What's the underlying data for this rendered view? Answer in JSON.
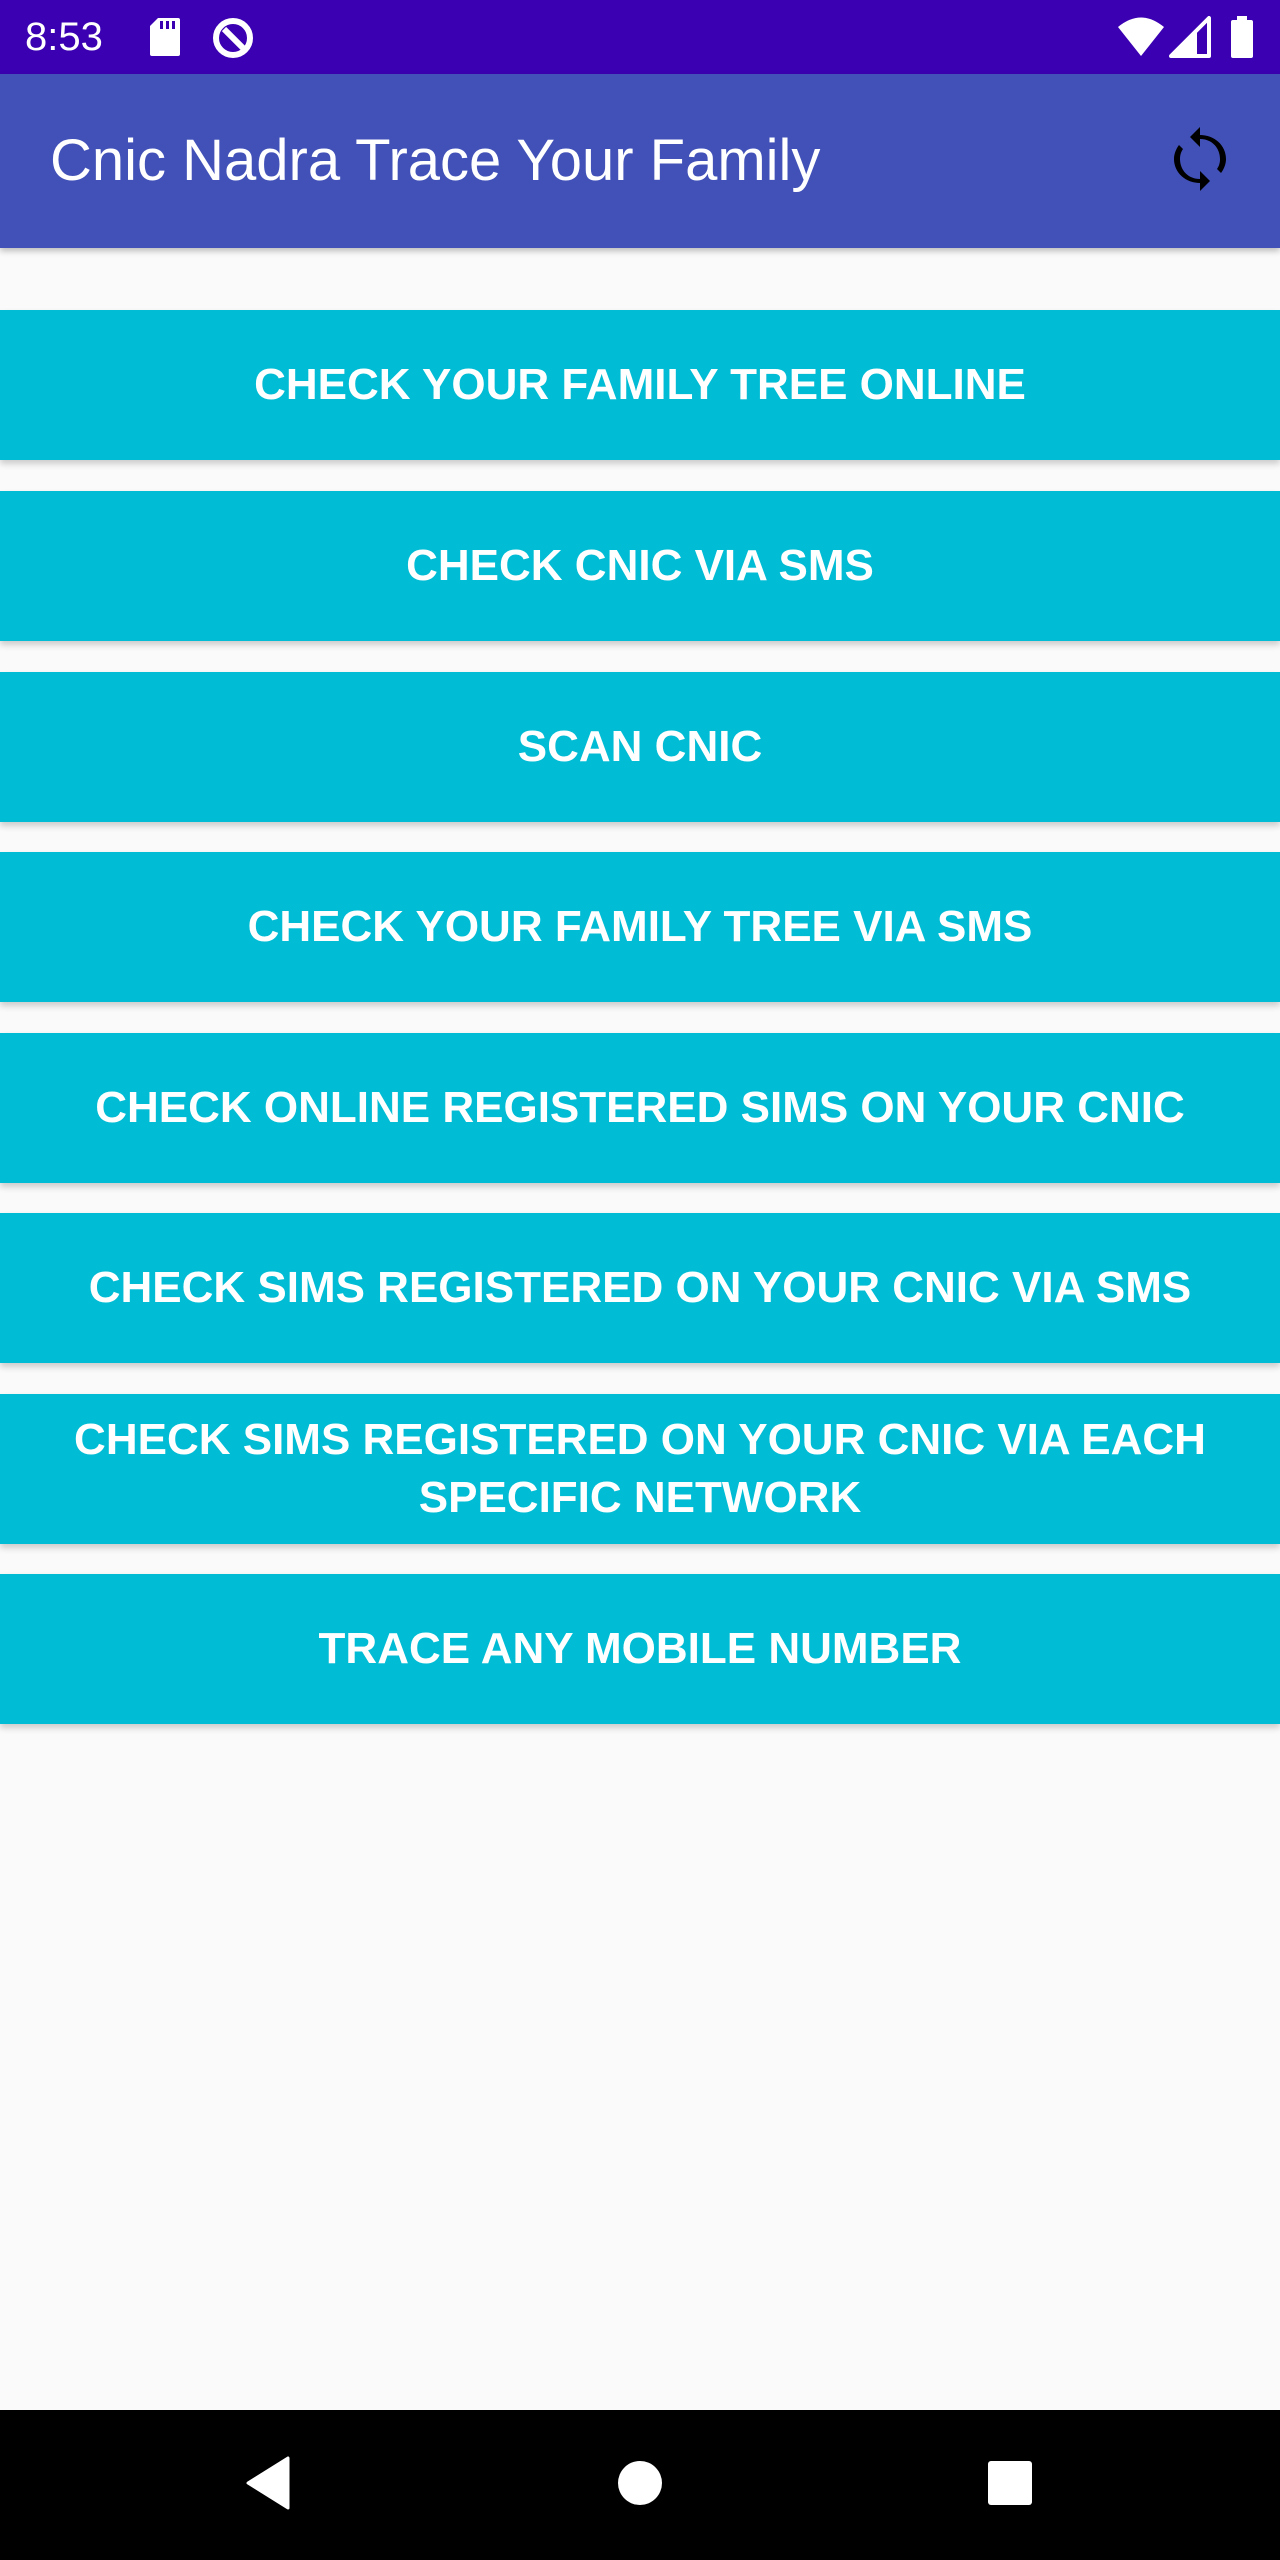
{
  "status_bar": {
    "time": "8:53",
    "icons": [
      "sd-card-icon",
      "data-saver-icon",
      "wifi-icon",
      "cell-signal-icon",
      "battery-icon"
    ]
  },
  "app_bar": {
    "title": "Cnic Nadra Trace Your Family",
    "refresh_icon": "refresh-icon"
  },
  "colors": {
    "status_bar": "#3a00b2",
    "app_bar": "#4151b8",
    "button": "#00bcd4",
    "background": "#fafafa",
    "nav_bar": "#000000"
  },
  "menu": {
    "items": [
      {
        "label": "CHECK YOUR FAMILY TREE ONLINE"
      },
      {
        "label": "CHECK CNIC VIA SMS"
      },
      {
        "label": "SCAN CNIC"
      },
      {
        "label": "CHECK YOUR FAMILY TREE VIA SMS"
      },
      {
        "label": "CHECK ONLINE REGISTERED SIMS ON YOUR CNIC"
      },
      {
        "label": "CHECK SIMS REGISTERED ON YOUR CNIC VIA SMS"
      },
      {
        "label": "CHECK SIMS REGISTERED ON YOUR CNIC VIA EACH\nSPECIFIC NETWORK"
      },
      {
        "label": "TRACE ANY MOBILE NUMBER"
      }
    ]
  },
  "nav_bar": {
    "icons": [
      "back-icon",
      "home-icon",
      "recents-icon"
    ]
  }
}
